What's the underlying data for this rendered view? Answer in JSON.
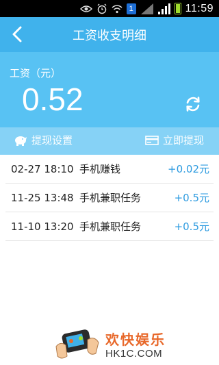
{
  "status_bar": {
    "time": "11:59",
    "sim_badge": "1",
    "icons": [
      "eye-icon",
      "alarm-icon",
      "wifi-icon",
      "sim-badge",
      "no-signal-icon",
      "signal-icon",
      "battery-icon"
    ]
  },
  "header": {
    "title": "工资收支明细"
  },
  "balance": {
    "label": "工资（元）",
    "value": "0.52"
  },
  "actions": {
    "withdraw_settings": "提现设置",
    "withdraw_now": "立即提现"
  },
  "transactions": [
    {
      "time": "02-27 18:10",
      "desc": "手机赚钱",
      "amount": "+0.02元"
    },
    {
      "time": "11-25 13:48",
      "desc": "手机兼职任务",
      "amount": "+0.5元"
    },
    {
      "time": "11-10 13:20",
      "desc": "手机兼职任务",
      "amount": "+0.5元"
    }
  ],
  "watermark": {
    "title": "欢快娱乐",
    "url": "HK1C.COM"
  },
  "colors": {
    "header_bg": "#40b2ec",
    "panel_bg": "#58c2f3",
    "action_bar_bg": "#86d2f6",
    "amount": "#2d9be0",
    "watermark_title": "#e8682a"
  }
}
